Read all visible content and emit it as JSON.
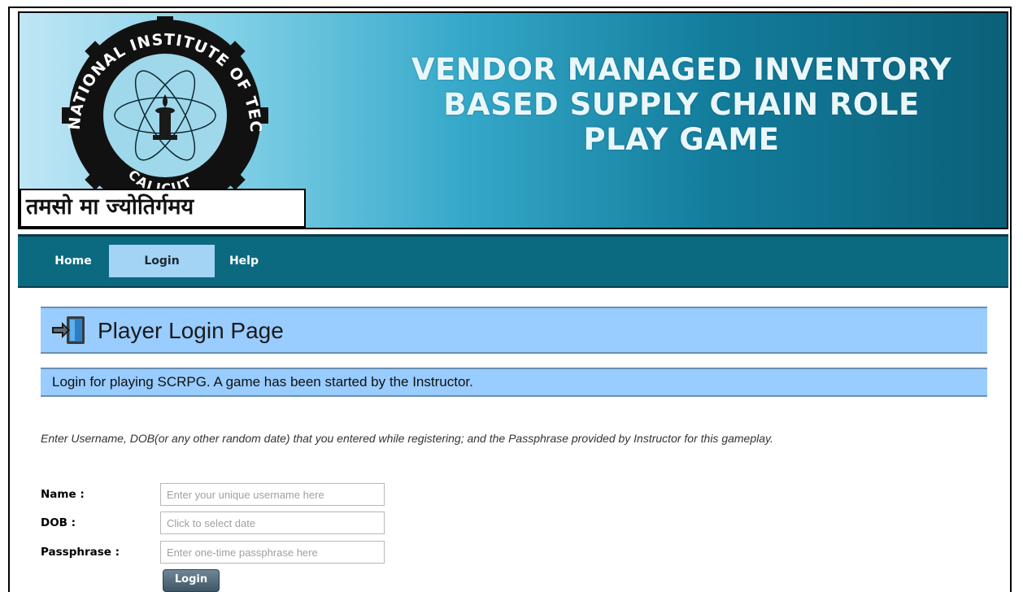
{
  "banner": {
    "title_lines": [
      "VENDOR MANAGED INVENTORY",
      "BASED SUPPLY CHAIN ROLE",
      "PLAY GAME"
    ],
    "logo_text_top": "NATIONAL INSTITUTE OF TECHNOLOGY",
    "logo_text_bottom": "CALICUT",
    "motto": "तमसो मा ज्योतिर्गमय"
  },
  "nav": {
    "items": [
      {
        "label": "Home",
        "active": false
      },
      {
        "label": "Login",
        "active": true
      },
      {
        "label": "Help",
        "active": false
      }
    ]
  },
  "page": {
    "title": "Player Login Page",
    "title_icon": "login-door-icon",
    "info": "Login for playing SCRPG. A game has been started by the Instructor.",
    "instructions": "Enter Username, DOB(or any other random date) that you entered while registering; and the Passphrase provided by Instructor for this gameplay."
  },
  "form": {
    "name_label": "Name :",
    "name_placeholder": "Enter your unique username here",
    "dob_label": "DOB :",
    "dob_placeholder": "Click to select date",
    "pass_label": "Passphrase :",
    "pass_placeholder": "Enter one-time passphrase here",
    "submit_label": "Login"
  },
  "colors": {
    "nav_bg": "#0b6a80",
    "nav_active": "#a3d4f5",
    "panel_bg": "#99ccff",
    "banner_title": "#e9f7fb"
  }
}
